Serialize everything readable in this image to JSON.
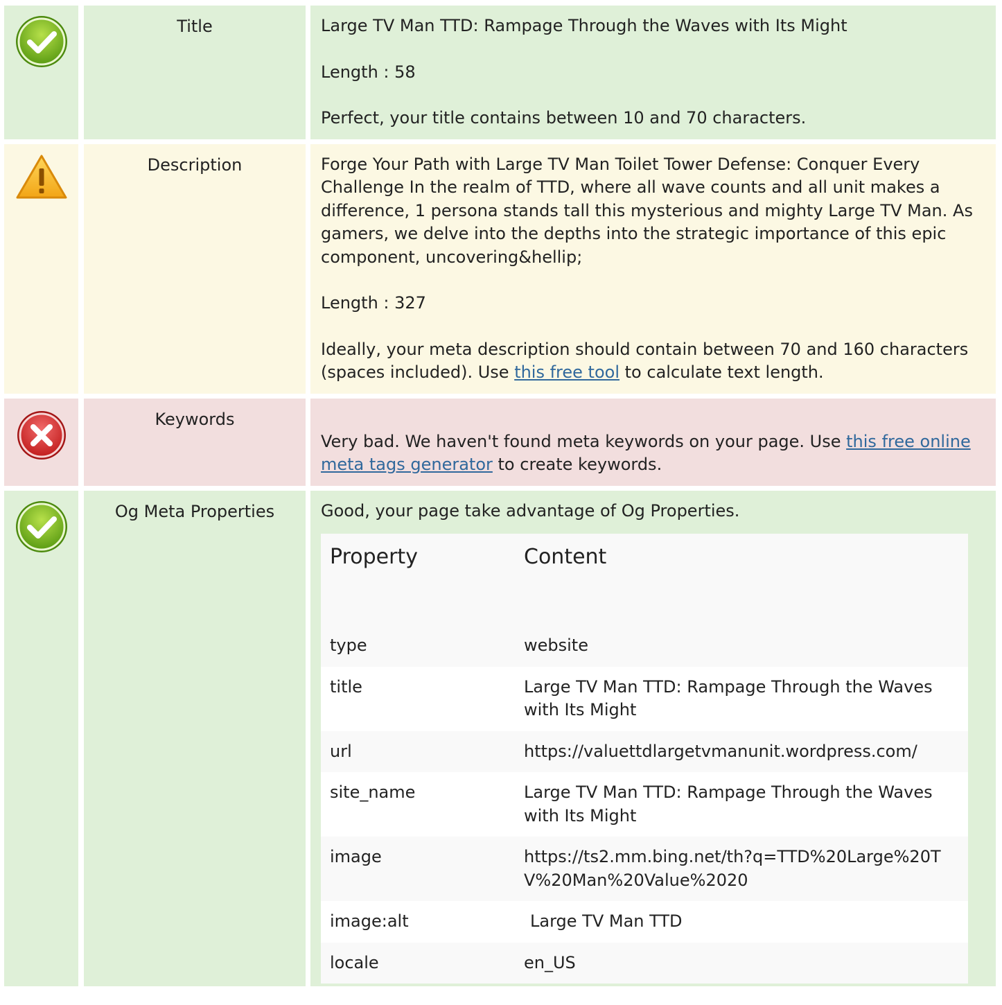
{
  "colors": {
    "good_bg": "#dff0d8",
    "warn_bg": "#fcf8e3",
    "bad_bg": "#f2dede",
    "link": "#30689c"
  },
  "rows": {
    "title": {
      "status_icon": "check-circle-icon",
      "label": "Title",
      "text": "Large TV Man TTD: Rampage Through the Waves with Its Might",
      "length": "Length : 58",
      "advice": "Perfect, your title contains between 10 and 70 characters."
    },
    "description": {
      "status_icon": "warning-triangle-icon",
      "label": "Description",
      "text": "Forge Your Path with Large TV Man Toilet Tower Defense: Conquer Every Challenge In the realm of TTD, where all wave counts and all unit makes a difference, 1 persona stands tall this mysterious and mighty Large TV Man. As gamers, we delve into the depths into the strategic importance of this epic component, uncovering&hellip;",
      "length": "Length : 327",
      "advice_before": "Ideally, your meta description should contain between 70 and 160 characters (spaces included). Use ",
      "advice_link": "this free tool",
      "advice_after": " to calculate text length."
    },
    "keywords": {
      "status_icon": "error-cross-icon",
      "label": "Keywords",
      "advice_before": "Very bad. We haven't found meta keywords on your page. Use ",
      "advice_link": "this free online meta tags generator",
      "advice_after": " to create keywords."
    },
    "og": {
      "status_icon": "check-circle-icon",
      "label": "Og Meta Properties",
      "summary": "Good, your page take advantage of Og Properties.",
      "table": {
        "header_property": "Property",
        "header_content": "Content",
        "rows": [
          {
            "property": "type",
            "content": "website"
          },
          {
            "property": "title",
            "content": "Large TV Man TTD: Rampage Through the Waves with Its Might"
          },
          {
            "property": "url",
            "content": "https://valuettdlargetvmanunit.wordpress.com/"
          },
          {
            "property": "site_name",
            "content": "Large TV Man TTD: Rampage Through the Waves with Its Might"
          },
          {
            "property": "image",
            "content": "https://ts2.mm.bing.net/th?q=TTD%20Large%20TV%20Man%20Value%2020"
          },
          {
            "property": "image:alt",
            "content": "Large TV Man TTD"
          },
          {
            "property": "locale",
            "content": "en_US"
          }
        ]
      }
    }
  }
}
